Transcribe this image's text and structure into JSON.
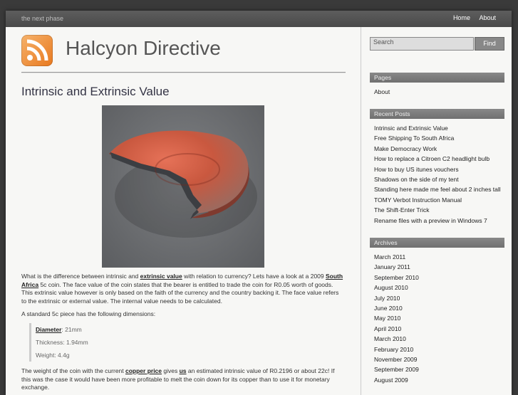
{
  "header": {
    "tagline": "the next phase",
    "nav": [
      "Home",
      "About"
    ],
    "site_title": "Halcyon Directive",
    "logo_icon": "rss-feed-icon"
  },
  "post": {
    "title": "Intrinsic and Extrinsic Value",
    "image_alt": "half coin",
    "paragraph1": {
      "t1": "What is the difference between intrinsic and ",
      "link1": "extrinsic value",
      "t2": " with relation to currency? Lets have a look at a 2009 ",
      "link2": "South Africa",
      "t3": " 5c coin. The face value of the coin states that the bearer is entitled to trade the coin for R0.05 worth of goods. This extrinsic value however is only based on the faith of the currency and the country backing it. The face value refers to the extrinsic or external value. The internal value needs to be calculated."
    },
    "paragraph2": "A standard 5c piece has the following dimensions:",
    "dimensions": {
      "diameter_label": "Diameter",
      "diameter_value": ": 21mm",
      "thickness": "Thickness: 1.94mm",
      "weight": "Weight: 4.4g"
    },
    "paragraph3": {
      "t1": "The weight of the coin with the current ",
      "link1": "copper price",
      "t2": " gives ",
      "link2": "us",
      "t3": " an estimated intrinsic value of R0.2196 or about 22c! If this was the case it would have been more profitable to melt the coin down for its copper than to use it for monetary exchange."
    }
  },
  "sidebar": {
    "search_placeholder": "Search",
    "search_button": "Find",
    "pages_heading": "Pages",
    "pages": [
      "About"
    ],
    "recent_heading": "Recent Posts",
    "recent_posts": [
      "Intrinsic and Extrinsic Value",
      "Free Shipping To South Africa",
      "Make Democracy Work",
      "How to replace a Citroen C2 headlight bulb",
      "How to buy US itunes vouchers",
      "Shadows on the side of my tent",
      "Standing here made me feel about 2 inches tall",
      "TOMY Verbot Instruction Manual",
      "The Shift-Enter Trick",
      "Rename files with a preview in Windows 7"
    ],
    "archives_heading": "Archives",
    "archives": [
      "March 2011",
      "January 2011",
      "September 2010",
      "August 2010",
      "July 2010",
      "June 2010",
      "May 2010",
      "April 2010",
      "March 2010",
      "February 2010",
      "November 2009",
      "September 2009",
      "August 2009"
    ]
  }
}
